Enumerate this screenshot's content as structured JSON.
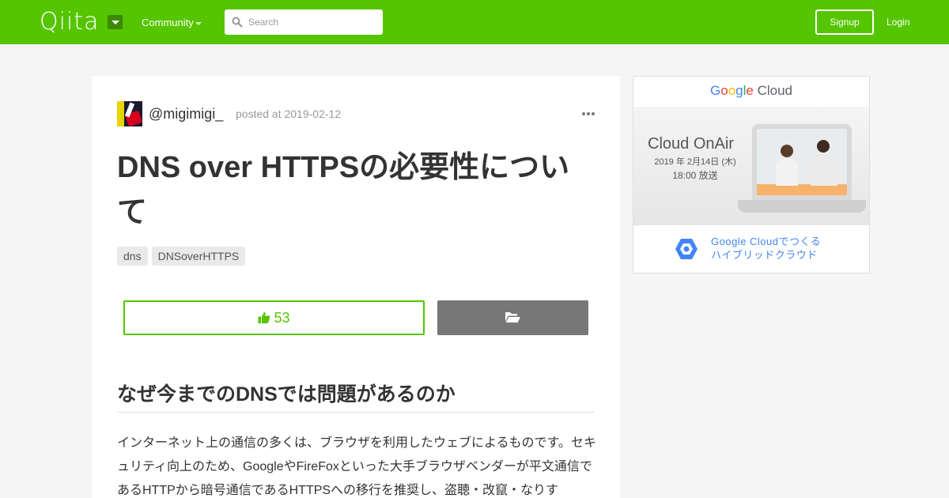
{
  "header": {
    "logo": "Qiita",
    "community_label": "Community",
    "search_placeholder": "Search",
    "signup_label": "Signup",
    "login_label": "Login",
    "colors": {
      "brand": "#55c500"
    }
  },
  "article": {
    "author": "@migimigi_",
    "posted": "posted at 2019-02-12",
    "title": "DNS over HTTPSの必要性について",
    "tags": [
      "dns",
      "DNSoverHTTPS"
    ],
    "likes": "53",
    "section_heading": "なぜ今までのDNSでは問題があるのか",
    "paragraph": "インターネット上の通信の多くは、ブラウザを利用したウェブによるものです。セキュリティ向上のため、GoogleやFireFoxといった大手ブラウザベンダーが平文通信であるHTTPから暗号通信であるHTTPSへの移行を推奨し、盗聴・改竄・なりす"
  },
  "ad": {
    "brand": "Google Cloud",
    "banner_title": "Cloud OnAir",
    "banner_date": "2019 年 2月14日 (木)",
    "banner_time": "18:00 放送",
    "cta_line1": "Google Cloudでつくる",
    "cta_line2": "ハイブリッドクラウド"
  }
}
